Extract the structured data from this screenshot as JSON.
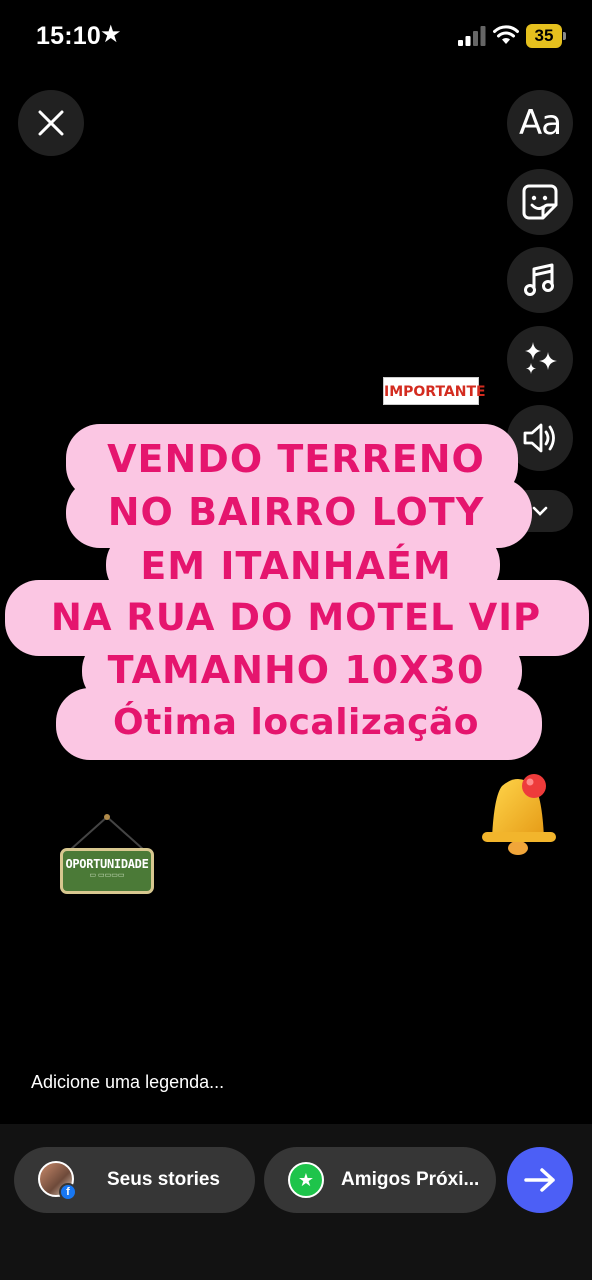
{
  "status_bar": {
    "time": "15:10",
    "battery_level": "35",
    "battery_color": "#e5c01e",
    "icons": [
      "star-icon",
      "signal-icon",
      "wifi-icon",
      "battery-icon"
    ]
  },
  "toolbar": {
    "text_tool_label": "Aa",
    "icons": [
      "close-icon",
      "text-icon",
      "sticker-icon",
      "music-icon",
      "sparkles-icon",
      "speaker-icon",
      "chevron-down-icon"
    ]
  },
  "story": {
    "text_color": "#e5156e",
    "background_color": "#fbc6e3",
    "lines": [
      "VENDO TERRENO",
      "NO BAIRRO LOTY",
      "EM ITANHAÉM",
      "NA RUA DO MOTEL VIP",
      "TAMANHO 10X30",
      "Ótima localização"
    ]
  },
  "stickers": {
    "importante": "IMPORTANTE",
    "oportunidade": "OPORTUNIDADE",
    "bell_icon": "bell-icon"
  },
  "caption": {
    "placeholder": "Adicione uma legenda..."
  },
  "share": {
    "your_stories": "Seus stories",
    "close_friends": "Amigos Próxi...",
    "accent_color": "#4c5ff6",
    "close_friends_color": "#1ec44b"
  }
}
